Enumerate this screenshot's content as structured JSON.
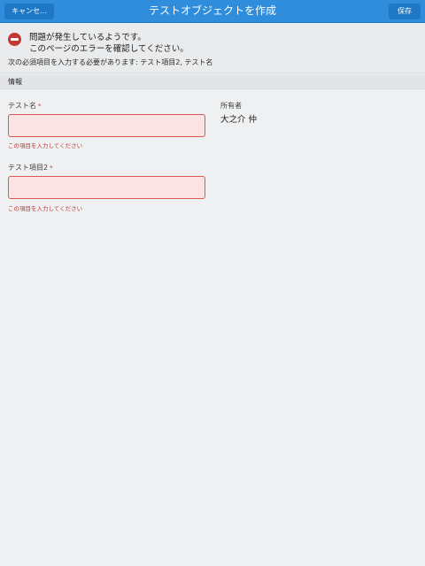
{
  "header": {
    "cancel_label": "キャンセ...",
    "title": "テストオブジェクトを作成",
    "save_label": "保存"
  },
  "error": {
    "line1": "問題が発生しているようです。",
    "line2": "このページのエラーを確認してください。",
    "required_message": "次の必須項目を入力する必要があります: テスト項目2, テスト名",
    "icon": "error-circle-icon",
    "color": "#c23934"
  },
  "section": {
    "title": "情報"
  },
  "fields": {
    "test_name": {
      "label": "テスト名",
      "required_marker": "*",
      "value": "",
      "error": "この項目を入力してください"
    },
    "test_item2": {
      "label": "テスト項目2",
      "required_marker": "*",
      "value": "",
      "error": "この項目を入力してください"
    },
    "owner": {
      "label": "所有者",
      "value": "大之介 仲"
    }
  },
  "colors": {
    "header": "#2f8ddb",
    "header_button": "#1f78c6",
    "error": "#c23934",
    "input_error_bg": "#f9e3e3",
    "background": "#eef0f2"
  }
}
